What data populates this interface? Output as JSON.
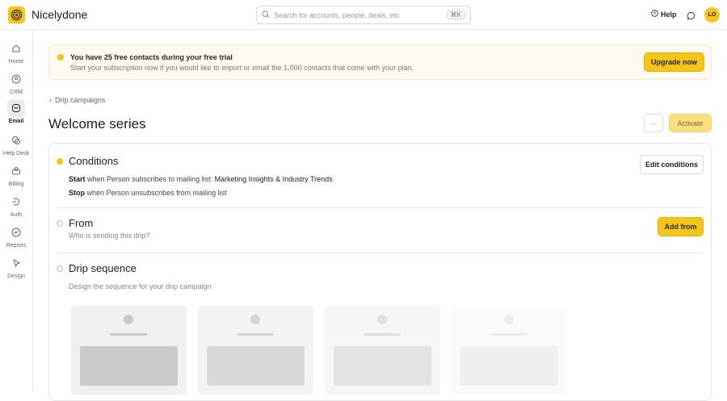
{
  "app": {
    "name": "Nicelydone"
  },
  "search": {
    "placeholder": "Search for accounts, people, deals, etc",
    "shortcut": "⌘K"
  },
  "header": {
    "help": "Help",
    "avatar": "LO"
  },
  "sidebar": {
    "items": [
      {
        "label": "Home"
      },
      {
        "label": "CRM"
      },
      {
        "label": "Email"
      },
      {
        "label": "Help Desk"
      },
      {
        "label": "Billing"
      },
      {
        "label": "Auth"
      },
      {
        "label": "Reports"
      },
      {
        "label": "Design"
      }
    ]
  },
  "banner": {
    "title": "You have 25 free contacts during your free trial",
    "text": "Start your subscription now if you would like to import or email the 1,000 contacts that come with your plan.",
    "button": "Upgrade now"
  },
  "breadcrumb": "Drip campaigns",
  "page": {
    "title": "Welcome series",
    "more": "···",
    "activate": "Activate"
  },
  "conditions": {
    "title": "Conditions",
    "edit": "Edit conditions",
    "start_kw": "Start",
    "start_text": "when Person subscribes to mailing list:",
    "start_list": "Marketing Insights & Industry Trends",
    "stop_kw": "Stop",
    "stop_text": "when Person unsubscribes from mailing list"
  },
  "from": {
    "title": "From",
    "subtitle": "Who is sending this drip?",
    "button": "Add from"
  },
  "drip": {
    "title": "Drip sequence",
    "subtitle": "Design the sequence for your drip campaign"
  },
  "colors": {
    "accent": "#f5c518"
  }
}
